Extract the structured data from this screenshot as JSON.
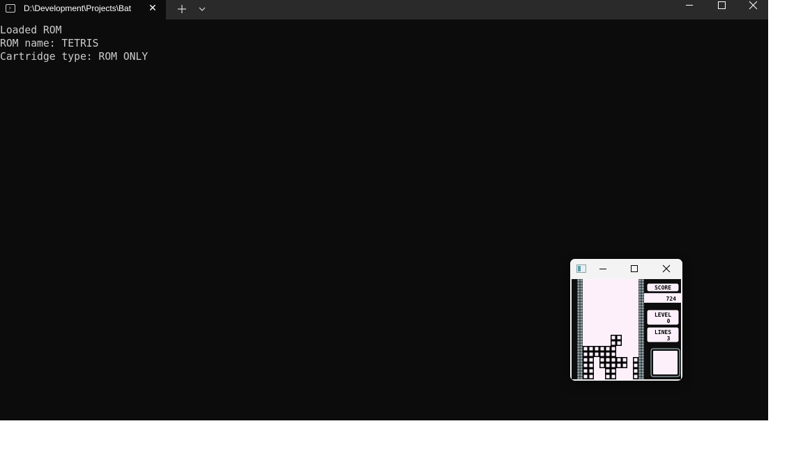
{
  "terminal": {
    "tab_title": "D:\\Development\\Projects\\Bat",
    "tab_icon": "terminal-icon",
    "lines": [
      "Loaded ROM",
      "ROM name: TETRIS",
      "Cartridge type: ROM ONLY"
    ],
    "colors": {
      "background": "#0c0c0c",
      "titlebar": "#2a2a2a",
      "text": "#cccccc"
    }
  },
  "emulator": {
    "game": {
      "score_label": "SCORE",
      "score_value": "724",
      "level_label": "LEVEL",
      "level_value": "0",
      "lines_label": "LINES",
      "lines_value": "3",
      "board": [
        "..........",
        "..........",
        "..........",
        "..........",
        "..........",
        "..........",
        "..........",
        "..........",
        "..........",
        "..........",
        ".....##...",
        ".....##...",
        "######....",
        "######....",
        "##.#####.#",
        "##.#####.#",
        "##..##...#",
        "##..##...#"
      ]
    },
    "colors": {
      "well_bg": "#fdf0fb",
      "block": "#000000"
    }
  }
}
